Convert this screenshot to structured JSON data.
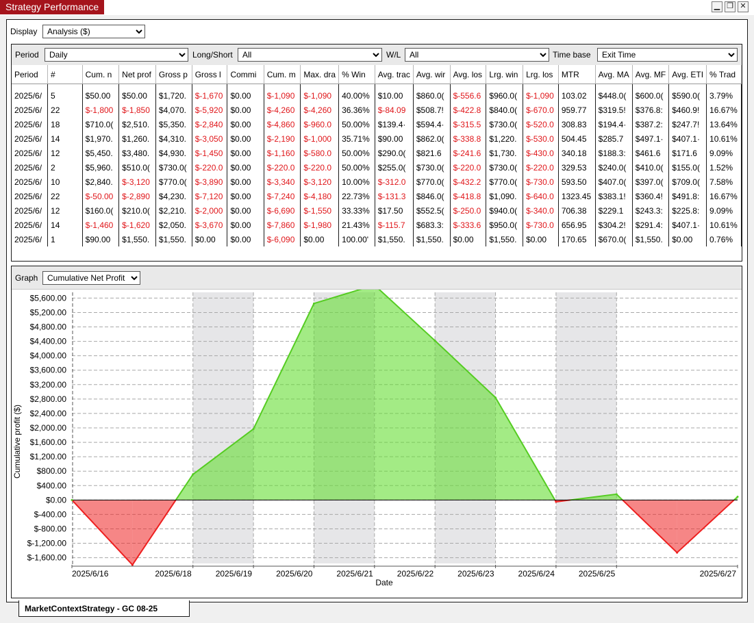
{
  "window": {
    "title": "Strategy Performance",
    "minimize": "▁",
    "maximize": "❐",
    "close": "✕"
  },
  "display": {
    "label": "Display",
    "value": "Analysis ($)"
  },
  "filters": {
    "period": {
      "label": "Period",
      "value": "Daily"
    },
    "long_short": {
      "label": "Long/Short",
      "value": "All"
    },
    "wl": {
      "label": "W/L",
      "value": "All"
    },
    "time_base": {
      "label": "Time base",
      "value": "Exit Time"
    }
  },
  "table": {
    "columns": [
      "Period",
      "#",
      "Cum. n",
      "Net prof",
      "Gross p",
      "Gross l",
      "Commi",
      "Cum. m",
      "Max. dra",
      "% Win",
      "Avg. trac",
      "Avg. wir",
      "Avg. los",
      "Lrg. win",
      "Lrg. los",
      "MTR",
      "Avg. MA",
      "Avg. MF",
      "Avg. ETI",
      "% Trad"
    ],
    "rows": [
      [
        "2025/6/",
        "5",
        "$50.00",
        "$50.00",
        "$1,720.",
        "$-1,670",
        "$0.00",
        "$-1,090",
        "$-1,090",
        "40.00%",
        "$10.00",
        "$860.0(",
        "$-556.6",
        "$960.0(",
        "$-1,090",
        "103.02",
        "$448.0(",
        "$600.0(",
        "$590.0(",
        "3.79%"
      ],
      [
        "2025/6/",
        "22",
        "$-1,800",
        "$-1,850",
        "$4,070.",
        "$-5,920",
        "$0.00",
        "$-4,260",
        "$-4,260",
        "36.36%",
        "$-84.09",
        "$508.7!",
        "$-422.8",
        "$840.0(",
        "$-670.0",
        "959.77",
        "$319.5!",
        "$376.8:",
        "$460.9!",
        "16.67%"
      ],
      [
        "2025/6/",
        "18",
        "$710.0(",
        "$2,510.",
        "$5,350.",
        "$-2,840",
        "$0.00",
        "$-4,860",
        "$-960.0",
        "50.00%",
        "$139.4·",
        "$594.4·",
        "$-315.5",
        "$730.0(",
        "$-520.0",
        "308.83",
        "$194.4·",
        "$387.2:",
        "$247.7!",
        "13.64%"
      ],
      [
        "2025/6/",
        "14",
        "$1,970.",
        "$1,260.",
        "$4,310.",
        "$-3,050",
        "$0.00",
        "$-2,190",
        "$-1,000",
        "35.71%",
        "$90.00",
        "$862.0(",
        "$-338.8",
        "$1,220.",
        "$-530.0",
        "504.45",
        "$285.7",
        "$497.1·",
        "$407.1·",
        "10.61%"
      ],
      [
        "2025/6/",
        "12",
        "$5,450.",
        "$3,480.",
        "$4,930.",
        "$-1,450",
        "$0.00",
        "$-1,160",
        "$-580.0",
        "50.00%",
        "$290.0(",
        "$821.6",
        "$-241.6",
        "$1,730.",
        "$-430.0",
        "340.18",
        "$188.3:",
        "$461.6",
        "$171.6",
        "9.09%"
      ],
      [
        "2025/6/",
        "2",
        "$5,960.",
        "$510.0(",
        "$730.0(",
        "$-220.0",
        "$0.00",
        "$-220.0",
        "$-220.0",
        "50.00%",
        "$255.0(",
        "$730.0(",
        "$-220.0",
        "$730.0(",
        "$-220.0",
        "329.53",
        "$240.0(",
        "$410.0(",
        "$155.0(",
        "1.52%"
      ],
      [
        "2025/6/",
        "10",
        "$2,840.",
        "$-3,120",
        "$770.0(",
        "$-3,890",
        "$0.00",
        "$-3,340",
        "$-3,120",
        "10.00%",
        "$-312.0",
        "$770.0(",
        "$-432.2",
        "$770.0(",
        "$-730.0",
        "593.50",
        "$407.0(",
        "$397.0(",
        "$709.0(",
        "7.58%"
      ],
      [
        "2025/6/",
        "22",
        "$-50.00",
        "$-2,890",
        "$4,230.",
        "$-7,120",
        "$0.00",
        "$-7,240",
        "$-4,180",
        "22.73%",
        "$-131.3",
        "$846.0(",
        "$-418.8",
        "$1,090.",
        "$-640.0",
        "1323.45",
        "$383.1!",
        "$360.4!",
        "$491.8:",
        "16.67%"
      ],
      [
        "2025/6/",
        "12",
        "$160.0(",
        "$210.0(",
        "$2,210.",
        "$-2,000",
        "$0.00",
        "$-6,690",
        "$-1,550",
        "33.33%",
        "$17.50",
        "$552.5(",
        "$-250.0",
        "$940.0(",
        "$-340.0",
        "706.38",
        "$229.1",
        "$243.3:",
        "$225.8:",
        "9.09%"
      ],
      [
        "2025/6/",
        "14",
        "$-1,460",
        "$-1,620",
        "$2,050.",
        "$-3,670",
        "$0.00",
        "$-7,860",
        "$-1,980",
        "21.43%",
        "$-115.7",
        "$683.3:",
        "$-333.6",
        "$950.0(",
        "$-730.0",
        "656.95",
        "$304.2!",
        "$291.4:",
        "$407.1·",
        "10.61%"
      ],
      [
        "2025/6/",
        "1",
        "$90.00",
        "$1,550.",
        "$1,550.",
        "$0.00",
        "$0.00",
        "$-6,090",
        "$0.00",
        "100.00'",
        "$1,550.",
        "$1,550.",
        "$0.00",
        "$1,550.",
        "$0.00",
        "170.65",
        "$670.0(",
        "$1,550.",
        "$0.00",
        "0.76%"
      ]
    ]
  },
  "graph": {
    "label": "Graph",
    "value": "Cumulative Net Profit"
  },
  "chart_data": {
    "type": "area",
    "xlabel": "Date",
    "ylabel": "Cumulative profit ($)",
    "ylim": [
      -1760,
      5760
    ],
    "x_tick_labels": [
      {
        "label": "2025/6/16",
        "x": 0
      },
      {
        "label": "2025/6/18",
        "x": 2
      },
      {
        "label": "2025/6/19",
        "x": 3
      },
      {
        "label": "2025/6/20",
        "x": 4
      },
      {
        "label": "2025/6/21",
        "x": 5
      },
      {
        "label": "2025/6/22",
        "x": 6
      },
      {
        "label": "2025/6/23",
        "x": 7
      },
      {
        "label": "2025/6/24",
        "x": 8
      },
      {
        "label": "2025/6/25",
        "x": 9
      },
      {
        "label": "2025/6/27",
        "x": 11
      }
    ],
    "y_ticks": [
      "$-1,600.00",
      "$-1,200.00",
      "$-800.00",
      "$-400.00",
      "$0.00",
      "$400.00",
      "$800.00",
      "$1,200.00",
      "$1,600.00",
      "$2,000.00",
      "$2,400.00",
      "$2,800.00",
      "$3,200.00",
      "$3,600.00",
      "$4,000.00",
      "$4,400.00",
      "$4,800.00",
      "$5,200.00",
      "$5,600.00"
    ],
    "y_tick_values": [
      -1600,
      -1200,
      -800,
      -400,
      0,
      400,
      800,
      1200,
      1600,
      2000,
      2400,
      2800,
      3200,
      3600,
      4000,
      4400,
      4800,
      5200,
      5600
    ],
    "x_max": 11,
    "shaded_bands": [
      [
        2,
        3
      ],
      [
        4,
        5
      ],
      [
        6,
        7
      ],
      [
        8,
        9
      ]
    ],
    "grid": "dashed",
    "series": [
      {
        "values": [
          {
            "x": 0,
            "y": 0
          },
          {
            "x": 1,
            "y": -1800
          },
          {
            "x": 2,
            "y": 710
          },
          {
            "x": 3,
            "y": 1970
          },
          {
            "x": 4,
            "y": 5450
          },
          {
            "x": 5,
            "y": 5960
          },
          {
            "x": 6,
            "y": 4420
          },
          {
            "x": 7,
            "y": 2840
          },
          {
            "x": 8,
            "y": -50
          },
          {
            "x": 9,
            "y": 160
          },
          {
            "x": 10,
            "y": -1460
          },
          {
            "x": 11,
            "y": 90
          }
        ],
        "positive_color": "#66dd33",
        "negative_color": "#ee2222"
      }
    ]
  },
  "status_tab": {
    "label": "MarketContextStrategy - GC 08-25"
  }
}
